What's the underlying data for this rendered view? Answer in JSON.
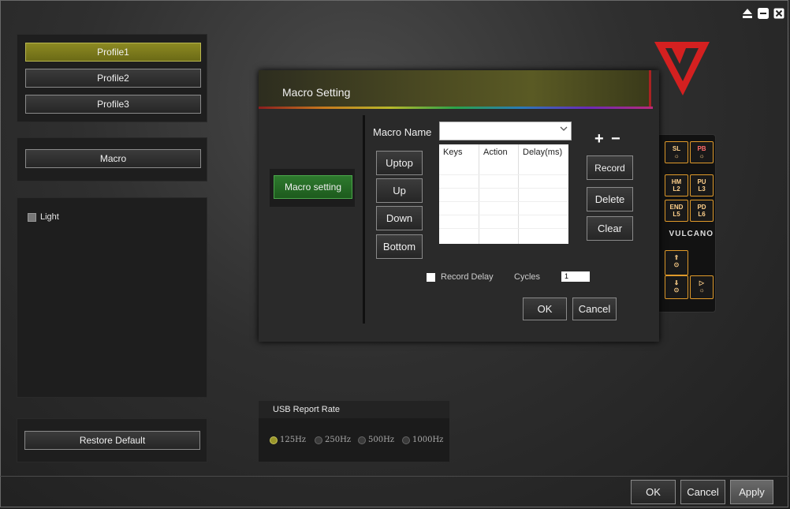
{
  "window": {
    "controls": [
      "eject-icon",
      "minimize-icon",
      "close-icon"
    ]
  },
  "profiles": {
    "items": [
      {
        "label": "Profile1",
        "active": true
      },
      {
        "label": "Profile2",
        "active": false
      },
      {
        "label": "Profile3",
        "active": false
      }
    ]
  },
  "macro": {
    "label": "Macro"
  },
  "light": {
    "label": "Light",
    "checked": false
  },
  "restore": {
    "label": "Restore Default"
  },
  "keyboard": {
    "brand": "VULCANO",
    "keys": [
      {
        "top": "SL",
        "bottom": "☼"
      },
      {
        "top": "PB",
        "bottom": "☼"
      },
      {
        "top": "HM",
        "bottom": "L2"
      },
      {
        "top": "PU",
        "bottom": "L3"
      },
      {
        "top": "END",
        "bottom": "L5"
      },
      {
        "top": "PD",
        "bottom": "L6"
      }
    ]
  },
  "dialog": {
    "title": "Macro Setting",
    "side_tab": "Macro setting",
    "macro_name_label": "Macro Name",
    "macro_name_value": "",
    "plus": "+",
    "minus": "−",
    "columns": [
      "Keys",
      "Action",
      "Delay(ms)"
    ],
    "rows": [],
    "order_buttons": [
      "Uptop",
      "Up",
      "Down",
      "Bottom"
    ],
    "action_buttons": [
      "Record",
      "Delete",
      "Clear"
    ],
    "record_delay_label": "Record Delay",
    "record_delay_checked": false,
    "cycles_label": "Cycles",
    "cycles_value": "1",
    "ok": "OK",
    "cancel": "Cancel"
  },
  "usb": {
    "title": "USB Report Rate",
    "options": [
      "125Hz",
      "250Hz",
      "500Hz",
      "1000Hz"
    ],
    "selected": "125Hz"
  },
  "footer": {
    "ok": "OK",
    "cancel": "Cancel",
    "apply": "Apply"
  },
  "colors": {
    "accent": "#8c8a22",
    "brand_red": "#d42020",
    "apply_bg": "#d8d8d8"
  }
}
